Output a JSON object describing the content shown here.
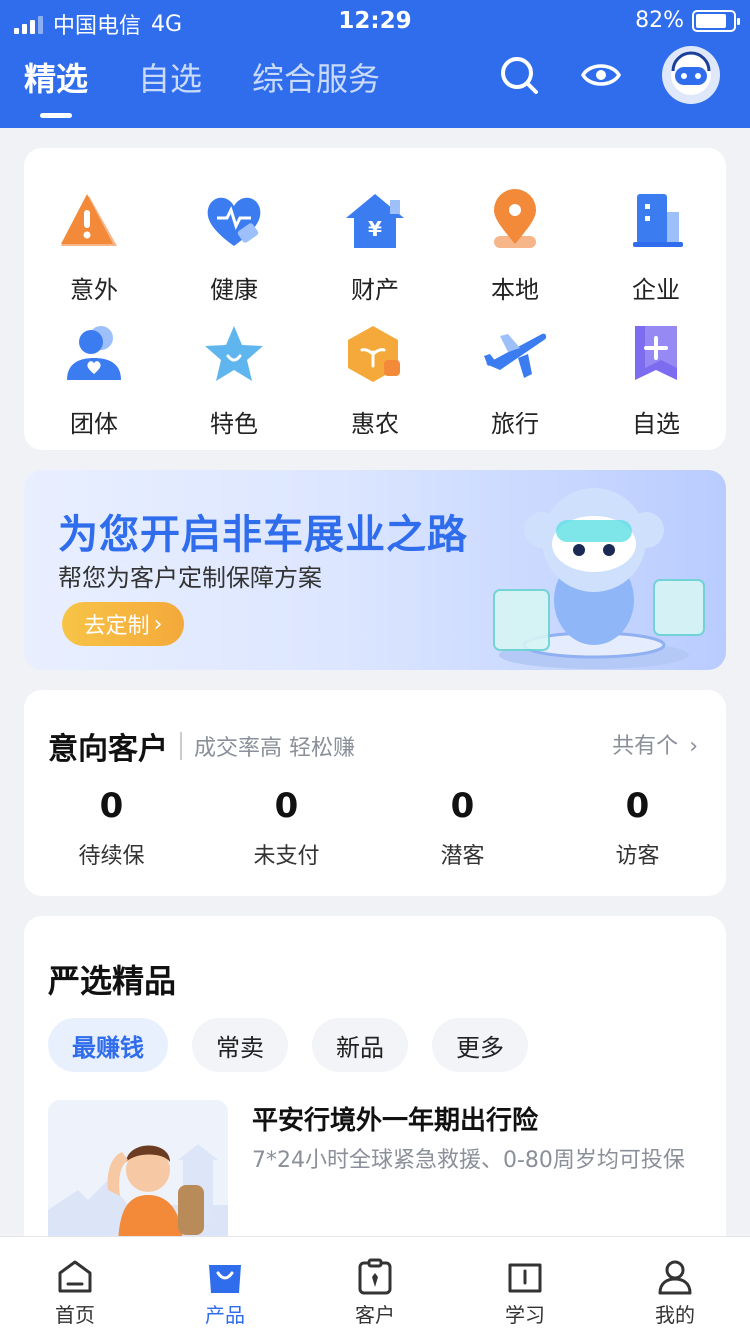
{
  "status": {
    "carrier": "中国电信",
    "network": "4G",
    "time": "12:29",
    "battery": "82%",
    "battery_level": 0.82
  },
  "header": {
    "tabs": [
      {
        "label": "精选",
        "active": true
      },
      {
        "label": "自选",
        "active": false
      },
      {
        "label": "综合服务",
        "active": false
      }
    ],
    "icons": [
      "search-icon",
      "eye-icon",
      "robot-avatar"
    ]
  },
  "categories": [
    {
      "label": "意外",
      "icon": "warning-icon"
    },
    {
      "label": "健康",
      "icon": "heart-pulse-icon"
    },
    {
      "label": "财产",
      "icon": "house-yen-icon"
    },
    {
      "label": "本地",
      "icon": "location-pin-icon"
    },
    {
      "label": "企业",
      "icon": "building-icon"
    },
    {
      "label": "团体",
      "icon": "group-icon"
    },
    {
      "label": "特色",
      "icon": "star-icon"
    },
    {
      "label": "惠农",
      "icon": "sprout-icon"
    },
    {
      "label": "旅行",
      "icon": "airplane-icon"
    },
    {
      "label": "自选",
      "icon": "bookmark-plus-icon"
    }
  ],
  "banner": {
    "title": "为您开启非车展业之路",
    "subtitle": "帮您为客户定制保障方案",
    "button": "去定制"
  },
  "intent": {
    "title": "意向客户",
    "subtitle": "成交率高 轻松赚",
    "more": "共有个",
    "stats": [
      {
        "value": "0",
        "label": "待续保"
      },
      {
        "value": "0",
        "label": "未支付"
      },
      {
        "value": "0",
        "label": "潜客"
      },
      {
        "value": "0",
        "label": "访客"
      }
    ]
  },
  "picks": {
    "title": "严选精品",
    "chips": [
      {
        "label": "最赚钱",
        "active": true
      },
      {
        "label": "常卖",
        "active": false
      },
      {
        "label": "新品",
        "active": false
      },
      {
        "label": "更多",
        "active": false
      }
    ],
    "product": {
      "name": "平安行境外一年期出行险",
      "desc": "7*24小时全球紧急救援、0-80周岁均可投保"
    }
  },
  "bottom_nav": [
    {
      "label": "首页",
      "icon": "home-icon",
      "active": false
    },
    {
      "label": "产品",
      "icon": "bag-icon",
      "active": true
    },
    {
      "label": "客户",
      "icon": "clipboard-icon",
      "active": false
    },
    {
      "label": "学习",
      "icon": "book-icon",
      "active": false
    },
    {
      "label": "我的",
      "icon": "user-icon",
      "active": false
    }
  ],
  "colors": {
    "brand_blue": "#2f6ded",
    "orange": "#f28a3a",
    "gold": "#f4b13e"
  }
}
